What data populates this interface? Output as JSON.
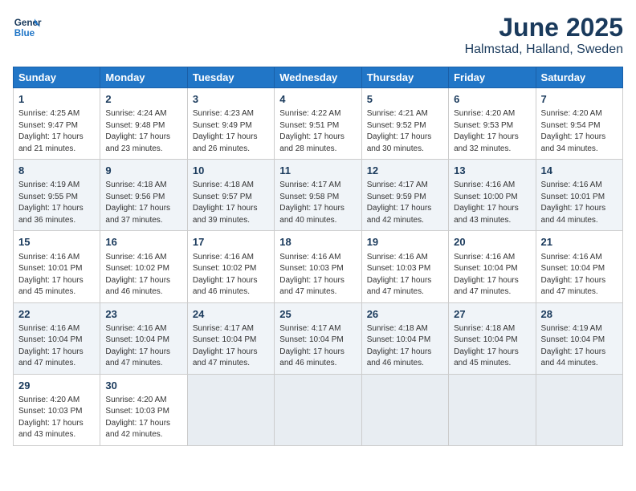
{
  "logo": {
    "line1": "General",
    "line2": "Blue"
  },
  "title": "June 2025",
  "subtitle": "Halmstad, Halland, Sweden",
  "weekdays": [
    "Sunday",
    "Monday",
    "Tuesday",
    "Wednesday",
    "Thursday",
    "Friday",
    "Saturday"
  ],
  "weeks": [
    [
      {
        "day": "1",
        "rise": "4:25 AM",
        "set": "9:47 PM",
        "daylight": "17 hours and 21 minutes."
      },
      {
        "day": "2",
        "rise": "4:24 AM",
        "set": "9:48 PM",
        "daylight": "17 hours and 23 minutes."
      },
      {
        "day": "3",
        "rise": "4:23 AM",
        "set": "9:49 PM",
        "daylight": "17 hours and 26 minutes."
      },
      {
        "day": "4",
        "rise": "4:22 AM",
        "set": "9:51 PM",
        "daylight": "17 hours and 28 minutes."
      },
      {
        "day": "5",
        "rise": "4:21 AM",
        "set": "9:52 PM",
        "daylight": "17 hours and 30 minutes."
      },
      {
        "day": "6",
        "rise": "4:20 AM",
        "set": "9:53 PM",
        "daylight": "17 hours and 32 minutes."
      },
      {
        "day": "7",
        "rise": "4:20 AM",
        "set": "9:54 PM",
        "daylight": "17 hours and 34 minutes."
      }
    ],
    [
      {
        "day": "8",
        "rise": "4:19 AM",
        "set": "9:55 PM",
        "daylight": "17 hours and 36 minutes."
      },
      {
        "day": "9",
        "rise": "4:18 AM",
        "set": "9:56 PM",
        "daylight": "17 hours and 37 minutes."
      },
      {
        "day": "10",
        "rise": "4:18 AM",
        "set": "9:57 PM",
        "daylight": "17 hours and 39 minutes."
      },
      {
        "day": "11",
        "rise": "4:17 AM",
        "set": "9:58 PM",
        "daylight": "17 hours and 40 minutes."
      },
      {
        "day": "12",
        "rise": "4:17 AM",
        "set": "9:59 PM",
        "daylight": "17 hours and 42 minutes."
      },
      {
        "day": "13",
        "rise": "4:16 AM",
        "set": "10:00 PM",
        "daylight": "17 hours and 43 minutes."
      },
      {
        "day": "14",
        "rise": "4:16 AM",
        "set": "10:01 PM",
        "daylight": "17 hours and 44 minutes."
      }
    ],
    [
      {
        "day": "15",
        "rise": "4:16 AM",
        "set": "10:01 PM",
        "daylight": "17 hours and 45 minutes."
      },
      {
        "day": "16",
        "rise": "4:16 AM",
        "set": "10:02 PM",
        "daylight": "17 hours and 46 minutes."
      },
      {
        "day": "17",
        "rise": "4:16 AM",
        "set": "10:02 PM",
        "daylight": "17 hours and 46 minutes."
      },
      {
        "day": "18",
        "rise": "4:16 AM",
        "set": "10:03 PM",
        "daylight": "17 hours and 47 minutes."
      },
      {
        "day": "19",
        "rise": "4:16 AM",
        "set": "10:03 PM",
        "daylight": "17 hours and 47 minutes."
      },
      {
        "day": "20",
        "rise": "4:16 AM",
        "set": "10:04 PM",
        "daylight": "17 hours and 47 minutes."
      },
      {
        "day": "21",
        "rise": "4:16 AM",
        "set": "10:04 PM",
        "daylight": "17 hours and 47 minutes."
      }
    ],
    [
      {
        "day": "22",
        "rise": "4:16 AM",
        "set": "10:04 PM",
        "daylight": "17 hours and 47 minutes."
      },
      {
        "day": "23",
        "rise": "4:16 AM",
        "set": "10:04 PM",
        "daylight": "17 hours and 47 minutes."
      },
      {
        "day": "24",
        "rise": "4:17 AM",
        "set": "10:04 PM",
        "daylight": "17 hours and 47 minutes."
      },
      {
        "day": "25",
        "rise": "4:17 AM",
        "set": "10:04 PM",
        "daylight": "17 hours and 46 minutes."
      },
      {
        "day": "26",
        "rise": "4:18 AM",
        "set": "10:04 PM",
        "daylight": "17 hours and 46 minutes."
      },
      {
        "day": "27",
        "rise": "4:18 AM",
        "set": "10:04 PM",
        "daylight": "17 hours and 45 minutes."
      },
      {
        "day": "28",
        "rise": "4:19 AM",
        "set": "10:04 PM",
        "daylight": "17 hours and 44 minutes."
      }
    ],
    [
      {
        "day": "29",
        "rise": "4:20 AM",
        "set": "10:03 PM",
        "daylight": "17 hours and 43 minutes."
      },
      {
        "day": "30",
        "rise": "4:20 AM",
        "set": "10:03 PM",
        "daylight": "17 hours and 42 minutes."
      },
      null,
      null,
      null,
      null,
      null
    ]
  ]
}
